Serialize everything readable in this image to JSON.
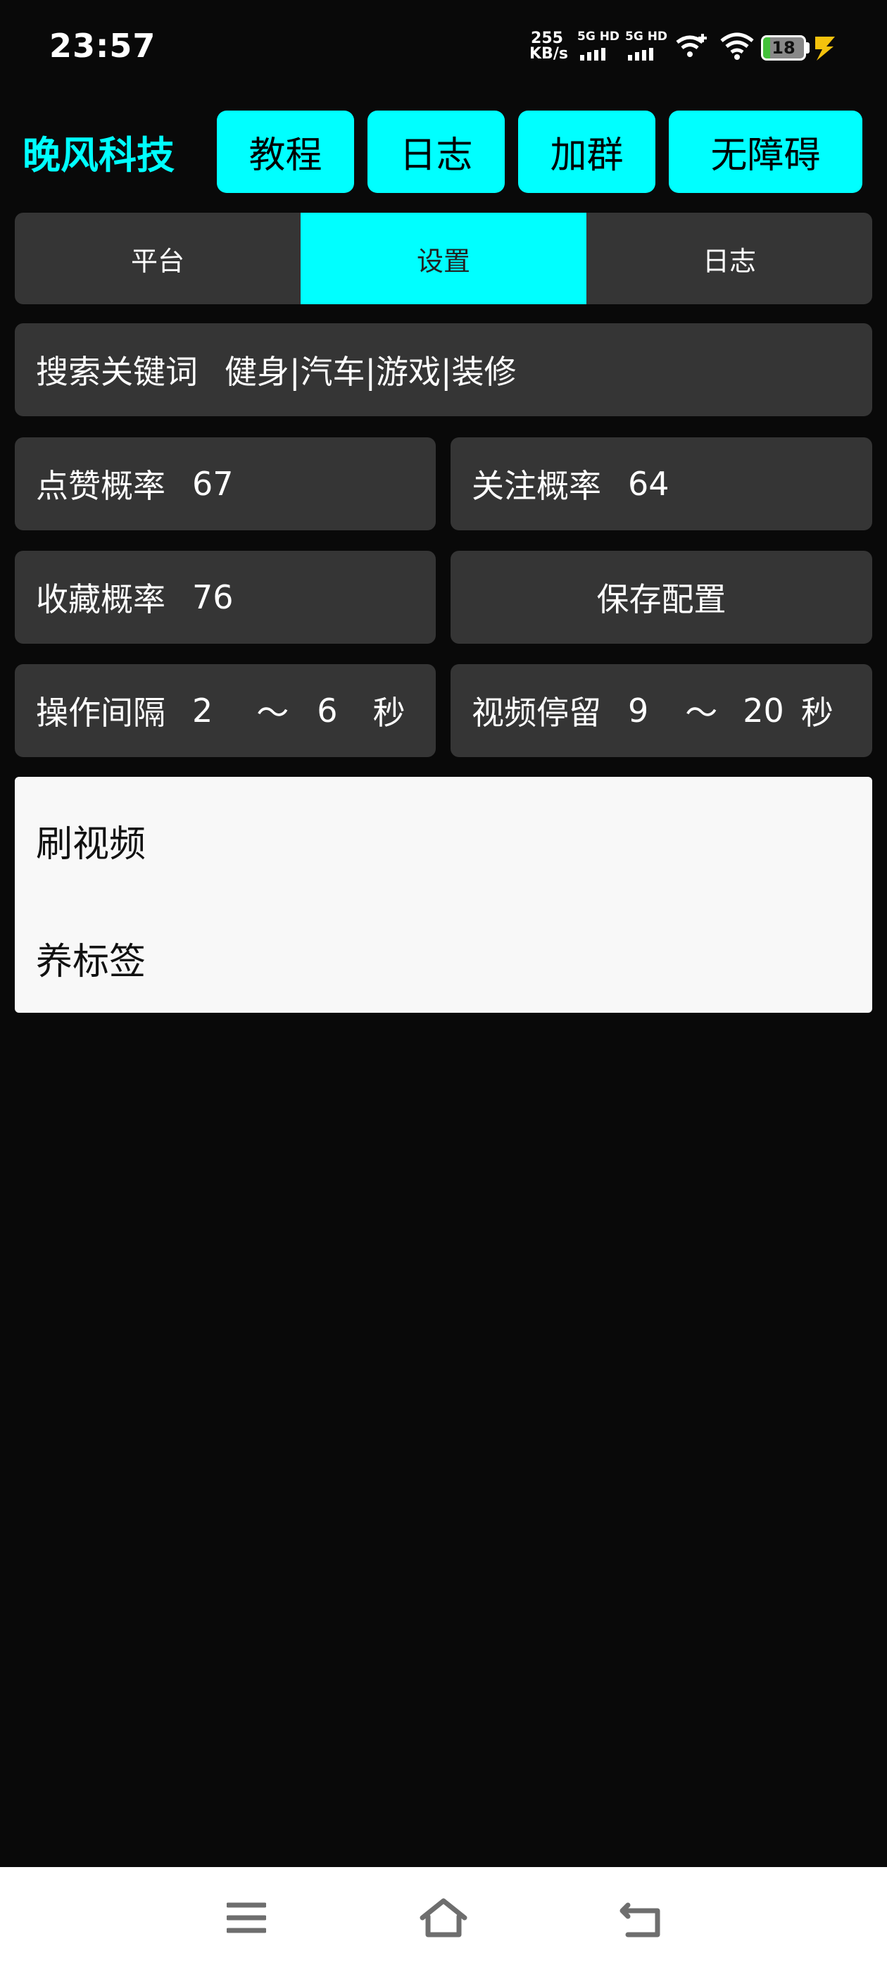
{
  "status_bar": {
    "time": "23:57",
    "net_speed_value": "255",
    "net_speed_unit": "KB/s",
    "sim1_label": "5G HD",
    "sim2_label": "5G HD",
    "battery_level": "18",
    "battery_fraction": 0.18,
    "icons": [
      "wifi-plus-icon",
      "wifi-icon",
      "battery-icon",
      "charging-bolt-icon"
    ]
  },
  "header": {
    "brand": "晚风科技",
    "buttons": [
      "教程",
      "日志",
      "加群",
      "无障碍"
    ],
    "accent_color": "#00ffff"
  },
  "tabs": [
    {
      "label": "平台",
      "active": false
    },
    {
      "label": "设置",
      "active": true
    },
    {
      "label": "日志",
      "active": false
    }
  ],
  "settings": {
    "search": {
      "label": "搜索关键词",
      "value": "健身|汽车|游戏|装修"
    },
    "like_rate": {
      "label": "点赞概率",
      "value": "67"
    },
    "follow_rate": {
      "label": "关注概率",
      "value": "64"
    },
    "collect_rate": {
      "label": "收藏概率",
      "value": "76"
    },
    "save_label": "保存配置",
    "interval": {
      "label": "操作间隔",
      "min": "2",
      "sep": "～",
      "max": "6",
      "unit": "秒"
    },
    "stay": {
      "label": "视频停留",
      "min": "9",
      "sep": "～",
      "max": "20",
      "unit": "秒"
    }
  },
  "mode_list": [
    "刷视频",
    "养标签"
  ],
  "nav": {
    "icons": [
      "menu-icon",
      "home-icon",
      "back-icon"
    ]
  }
}
